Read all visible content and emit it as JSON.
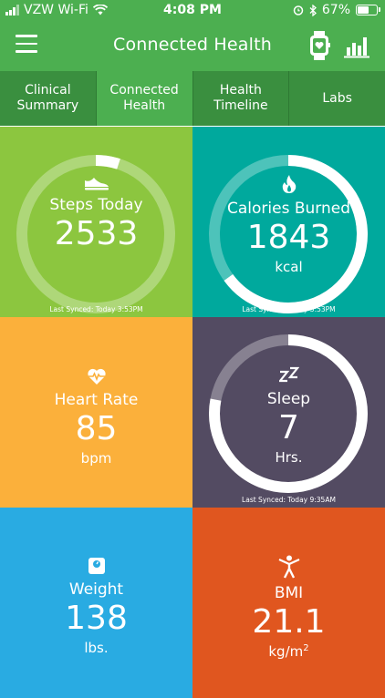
{
  "status_bar": {
    "carrier": "VZW Wi-Fi",
    "time": "4:08 PM",
    "battery": "67%",
    "battery_level": 0.67
  },
  "nav": {
    "title": "Connected Health"
  },
  "tabs": [
    {
      "label": "Clinical\nSummary",
      "active": false
    },
    {
      "label": "Connected\nHealth",
      "active": true
    },
    {
      "label": "Health\nTimeline",
      "active": false
    },
    {
      "label": "Labs",
      "active": false
    }
  ],
  "tiles": {
    "steps": {
      "label": "Steps Today",
      "value": "2533",
      "sync": "Last Synced: Today 3:53PM",
      "progress": 0.05,
      "color": "#8cc63f",
      "icon": "shoe-icon"
    },
    "calories": {
      "label": "Calories Burned",
      "value": "1843",
      "unit": "kcal",
      "sync": "Last Synced: Today 3:53PM",
      "progress": 0.65,
      "color": "#00a99d",
      "icon": "flame-icon"
    },
    "heart": {
      "label": "Heart Rate",
      "value": "85",
      "unit": "bpm",
      "color": "#fbb03b",
      "icon": "heart-pulse-icon"
    },
    "sleep": {
      "label": "Sleep",
      "value": "7",
      "unit": "Hrs.",
      "sync": "Last Synced: Today 9:35AM",
      "progress": 0.78,
      "color": "#534b62",
      "icon": "sleep-zz-icon"
    },
    "weight": {
      "label": "Weight",
      "value": "138",
      "unit": "lbs.",
      "color": "#29abe2",
      "icon": "scale-icon"
    },
    "bmi": {
      "label": "BMI",
      "value": "21.1",
      "unit_base": "kg/m",
      "unit_sup": "2",
      "color": "#e0561f",
      "icon": "person-icon"
    }
  }
}
